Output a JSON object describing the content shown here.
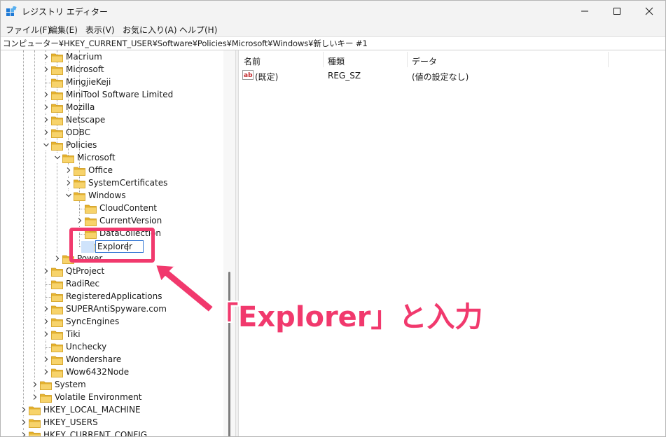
{
  "window": {
    "title": "レジストリ エディター",
    "minimize_label": "",
    "maximize_label": "",
    "close_label": ""
  },
  "menu": [
    {
      "label": "ファイル(F)"
    },
    {
      "label": "編集(E)"
    },
    {
      "label": "表示(V)"
    },
    {
      "label": "お気に入り(A)"
    },
    {
      "label": "ヘルプ(H)"
    }
  ],
  "address": {
    "path": "コンピューター¥HKEY_CURRENT_USER¥Software¥Policies¥Microsoft¥Windows¥新しいキー #1"
  },
  "tree": {
    "items": [
      {
        "label": "Macrium",
        "level": 3,
        "expander": "collapsed"
      },
      {
        "label": "Microsoft",
        "level": 3,
        "expander": "collapsed"
      },
      {
        "label": "MingjieKeji",
        "level": 3,
        "expander": "none"
      },
      {
        "label": "MiniTool Software Limited",
        "level": 3,
        "expander": "collapsed"
      },
      {
        "label": "Mozilla",
        "level": 3,
        "expander": "collapsed"
      },
      {
        "label": "Netscape",
        "level": 3,
        "expander": "collapsed"
      },
      {
        "label": "ODBC",
        "level": 3,
        "expander": "collapsed"
      },
      {
        "label": "Policies",
        "level": 3,
        "expander": "expanded"
      },
      {
        "label": "Microsoft",
        "level": 4,
        "expander": "expanded"
      },
      {
        "label": "Office",
        "level": 5,
        "expander": "collapsed"
      },
      {
        "label": "SystemCertificates",
        "level": 5,
        "expander": "collapsed"
      },
      {
        "label": "Windows",
        "level": 5,
        "expander": "expanded"
      },
      {
        "label": "CloudContent",
        "level": 6,
        "expander": "none"
      },
      {
        "label": "CurrentVersion",
        "level": 6,
        "expander": "collapsed"
      },
      {
        "label": "DataCollection",
        "level": 6,
        "expander": "none"
      },
      {
        "label": "",
        "level": 6,
        "expander": "none",
        "editing": true
      },
      {
        "label": "Power",
        "level": 4,
        "expander": "collapsed"
      },
      {
        "label": "QtProject",
        "level": 3,
        "expander": "collapsed"
      },
      {
        "label": "RadiRec",
        "level": 3,
        "expander": "none"
      },
      {
        "label": "RegisteredApplications",
        "level": 3,
        "expander": "none"
      },
      {
        "label": "SUPERAntiSpyware.com",
        "level": 3,
        "expander": "collapsed"
      },
      {
        "label": "SyncEngines",
        "level": 3,
        "expander": "collapsed"
      },
      {
        "label": "Tiki",
        "level": 3,
        "expander": "collapsed"
      },
      {
        "label": "Unchecky",
        "level": 3,
        "expander": "none"
      },
      {
        "label": "Wondershare",
        "level": 3,
        "expander": "collapsed"
      },
      {
        "label": "Wow6432Node",
        "level": 3,
        "expander": "collapsed"
      },
      {
        "label": "System",
        "level": 2,
        "expander": "collapsed"
      },
      {
        "label": "Volatile Environment",
        "level": 2,
        "expander": "collapsed"
      },
      {
        "label": "HKEY_LOCAL_MACHINE",
        "level": 1,
        "expander": "collapsed"
      },
      {
        "label": "HKEY_USERS",
        "level": 1,
        "expander": "collapsed"
      },
      {
        "label": "HKEY_CURRENT_CONFIG",
        "level": 1,
        "expander": "collapsed"
      }
    ],
    "edit_value": "Explorer"
  },
  "list": {
    "columns": [
      "名前",
      "種類",
      "データ"
    ],
    "rows": [
      {
        "name": "(既定)",
        "type": "REG_SZ",
        "data": "(値の設定なし)"
      }
    ]
  },
  "annotation": {
    "callout": "「Explorer」と入力"
  },
  "colors": {
    "accent": "#f1396d",
    "folder": "#f4c542",
    "selection": "#cfe3fb"
  },
  "icons": {
    "app": "registry-icon",
    "value": "string-value-icon",
    "folder": "folder-icon"
  }
}
